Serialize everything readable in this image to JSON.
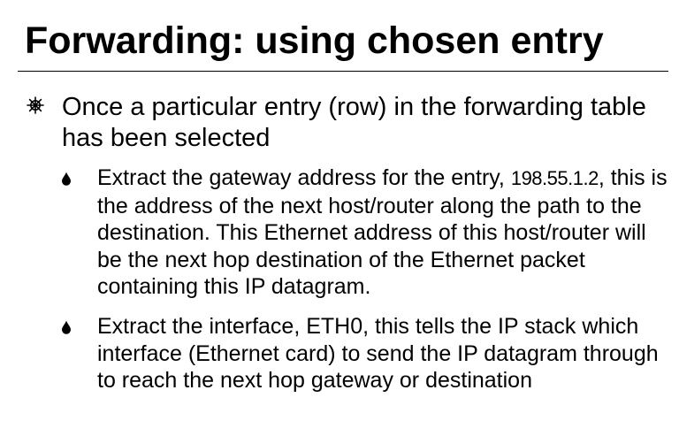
{
  "title": "Forwarding: using chosen entry",
  "main_point": "Once a particular entry (row) in the forwarding table has been selected",
  "sub_points": [
    {
      "text_before": "Extract the gateway address for the entry, ",
      "gateway": "198.55.1.2",
      "text_after": ", this is the address of the next host/router along the path to the destination.  This Ethernet address of this host/router will be the next hop destination of the Ethernet packet containing this IP datagram."
    },
    {
      "text": "Extract the interface,  ETH0, this tells the IP stack which interface (Ethernet card) to send the IP datagram through to reach the next hop gateway or destination"
    }
  ]
}
